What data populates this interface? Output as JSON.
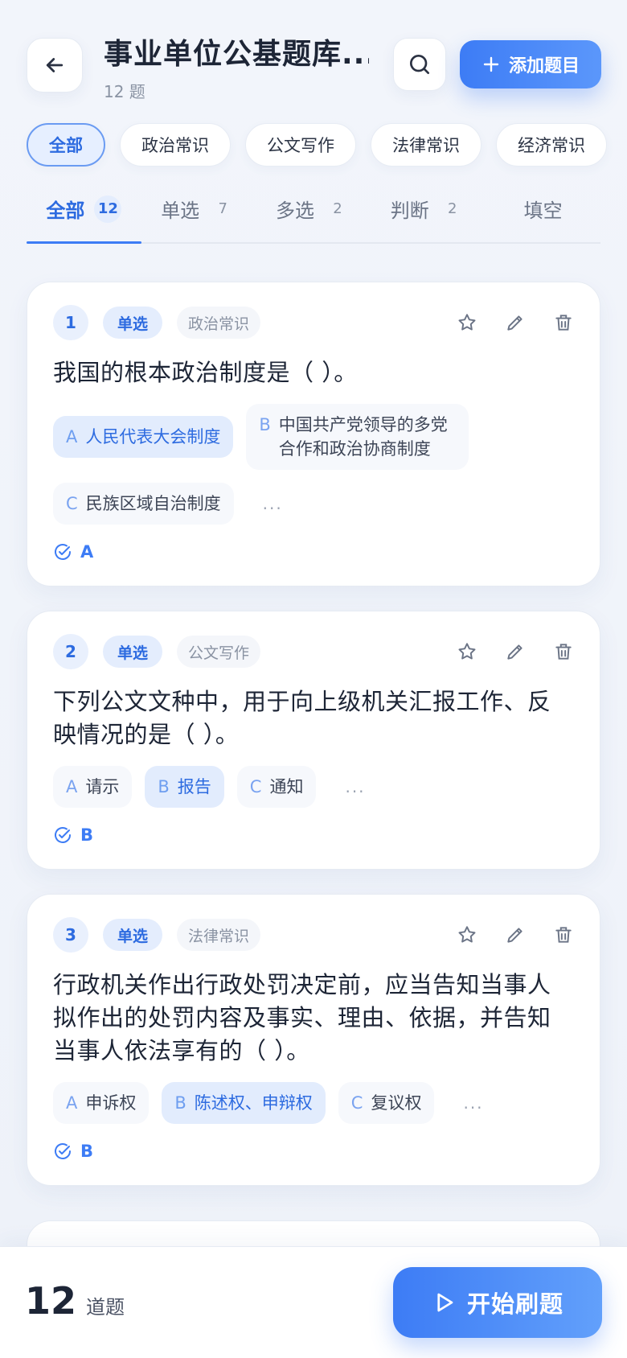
{
  "header": {
    "title": "事业单位公基题库...",
    "subtitle": "12 题",
    "add_label": "添加题目"
  },
  "categories": [
    "全部",
    "政治常识",
    "公文写作",
    "法律常识",
    "经济常识"
  ],
  "tabs": [
    {
      "label": "全部",
      "count": "12"
    },
    {
      "label": "单选",
      "count": "7"
    },
    {
      "label": "多选",
      "count": "2"
    },
    {
      "label": "判断",
      "count": "2"
    },
    {
      "label": "填空",
      "count": ""
    }
  ],
  "questions": [
    {
      "num": "1",
      "type": "单选",
      "category": "政治常识",
      "text": "我国的根本政治制度是（ ）。",
      "options": [
        {
          "letter": "A",
          "text": "人民代表大会制度"
        },
        {
          "letter": "B",
          "text": "中国共产党领导的多党合作和政治协商制度"
        },
        {
          "letter": "C",
          "text": "民族区域自治制度"
        }
      ],
      "more": "...",
      "answer": "A"
    },
    {
      "num": "2",
      "type": "单选",
      "category": "公文写作",
      "text": "下列公文文种中，用于向上级机关汇报工作、反映情况的是（ ）。",
      "options": [
        {
          "letter": "A",
          "text": "请示"
        },
        {
          "letter": "B",
          "text": "报告"
        },
        {
          "letter": "C",
          "text": "通知"
        }
      ],
      "more": "...",
      "answer": "B"
    },
    {
      "num": "3",
      "type": "单选",
      "category": "法律常识",
      "text": "行政机关作出行政处罚决定前，应当告知当事人拟作出的处罚内容及事实、理由、依据，并告知当事人依法享有的（ ）。",
      "options": [
        {
          "letter": "A",
          "text": "申诉权"
        },
        {
          "letter": "B",
          "text": "陈述权、申辩权"
        },
        {
          "letter": "C",
          "text": "复议权"
        }
      ],
      "more": "...",
      "answer": "B"
    }
  ],
  "footer": {
    "total": "12",
    "unit": "道题",
    "start_label": "开始刷题"
  },
  "colors": {
    "accent": "#3d7cf5",
    "accent_light": "#e4edfd"
  }
}
